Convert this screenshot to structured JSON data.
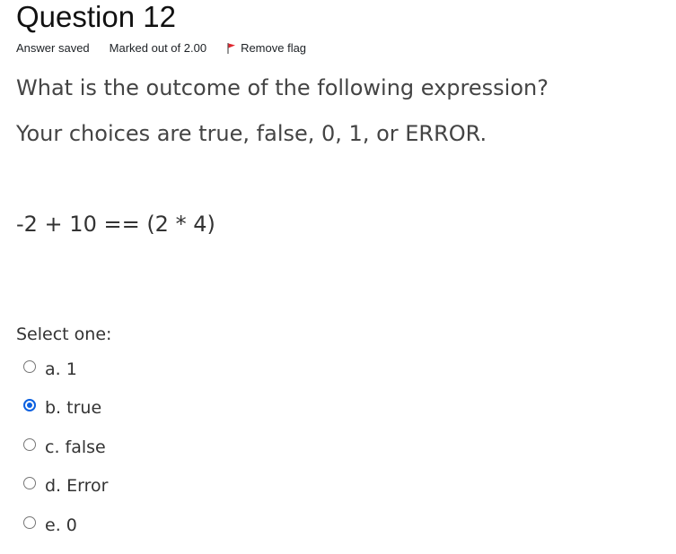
{
  "question": {
    "title": "Question 12",
    "state": "Answer saved",
    "grade": "Marked out of 2.00",
    "flag_label": "Remove flag",
    "flag_icon": "flag-icon",
    "flag_color": "#e0262e",
    "text_line1": "What is the outcome of the following expression?",
    "text_line2": "Your choices are true, false, 0, 1, or  ERROR.",
    "expression": "-2 + 10 == (2 * 4)",
    "prompt": "Select one:",
    "answers": [
      {
        "label": "a. 1",
        "checked": false
      },
      {
        "label": "b. true",
        "checked": true
      },
      {
        "label": "c. false",
        "checked": false
      },
      {
        "label": "d. Error",
        "checked": false
      },
      {
        "label": "e. 0",
        "checked": false
      }
    ],
    "selected_color": "#0b60e0"
  }
}
